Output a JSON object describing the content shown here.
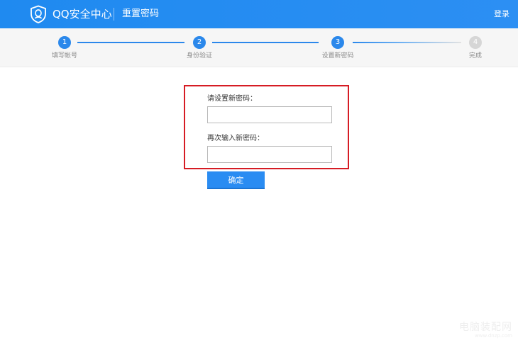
{
  "header": {
    "brand": "QQ安全中心",
    "page_label": "重置密码",
    "login": "登录",
    "logo_icon": "qq-shield-icon",
    "bg_color": "#2b8cf2"
  },
  "steps": [
    {
      "number": "1",
      "label": "填写帐号",
      "state": "done"
    },
    {
      "number": "2",
      "label": "身份验证",
      "state": "done"
    },
    {
      "number": "3",
      "label": "设置新密码",
      "state": "current"
    },
    {
      "number": "4",
      "label": "完成",
      "state": "pending"
    }
  ],
  "form": {
    "new_password_label": "请设置新密码：",
    "new_password_value": "",
    "confirm_password_label": "再次输入新密码：",
    "confirm_password_value": "",
    "confirm_button": "确定",
    "highlight_color": "#d61c24",
    "accent_color": "#2b88eb"
  },
  "watermark": {
    "main": "电脑装配网",
    "sub": "www.dnzp.com"
  }
}
